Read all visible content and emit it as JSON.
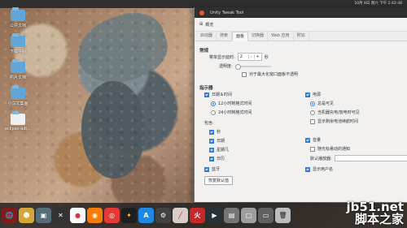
{
  "desktop": {
    "icons": [
      {
        "label": "公共文档"
      },
      {
        "label": "下载中服"
      },
      {
        "label": "照片文档"
      },
      {
        "label": "小鸟文集画"
      },
      {
        "label": "eclipse-adt..."
      }
    ]
  },
  "topbar": {
    "time": "10月 8日 周六 下午 2:42:48"
  },
  "window": {
    "title": "Unity Tweak Tool",
    "overview": "概览",
    "tabs": [
      "启动器",
      "搜索",
      "面板",
      "切换器",
      "Web 应用",
      "附加"
    ],
    "panel": {
      "general_title": "常规",
      "menu_delay_label": "菜单显示延时:",
      "menu_delay_value": "2",
      "minus": "-",
      "plus": "+",
      "seconds": "秒",
      "transparency_label": "透明度:",
      "opaque_label": "对于最大化窗口面板不透明",
      "indicators_title": "指示器",
      "datetime_label": "日期＆时间",
      "format12": "12小时制格式时间",
      "format24": "24小时制格式时间",
      "include_label": "包含:",
      "seconds_item": "秒",
      "date_item": "日期",
      "weekday_item": "星期几",
      "calendar_item": "日历",
      "bluetooth_item": "蓝牙",
      "restore_button": "恢复默认值",
      "power_label": "电源",
      "always_visible": "总是可见",
      "charging_visible": "当机器充电/放电时可见",
      "show_remaining": "显示剩余电池续航时间",
      "volume_label": "音量",
      "scroll_notify": "随光标悬动的通知",
      "default_player": "默认播放器:",
      "show_username": "显示用户名"
    }
  },
  "dock": {
    "apps": [
      "Web",
      "Cam",
      "Mac",
      "Tool",
      "Chrome",
      "Firefox",
      "Weibo",
      "Dev",
      "Store",
      "Settings",
      "Text",
      "Fire",
      "Term",
      "Files",
      "Tray",
      "Disk",
      "Trash"
    ]
  },
  "watermark": {
    "line1": "jb51.net",
    "line2": "脚本之家"
  }
}
